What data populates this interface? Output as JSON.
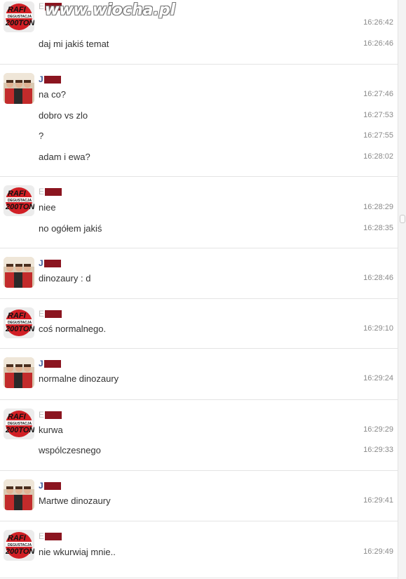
{
  "watermark": "www.wiocha.pl",
  "scrollbar": {},
  "groups": [
    {
      "sender_initial": "E",
      "messages": [
        {
          "text": "",
          "time": "16:26:42"
        },
        {
          "text": "daj mi jakiś temat",
          "time": "16:26:46"
        }
      ]
    },
    {
      "sender_initial": "J",
      "messages": [
        {
          "text": "na co?",
          "time": "16:27:46"
        },
        {
          "text": "dobro vs zlo",
          "time": "16:27:53"
        },
        {
          "text": "?",
          "time": "16:27:55"
        },
        {
          "text": "adam i ewa?",
          "time": "16:28:02"
        }
      ]
    },
    {
      "sender_initial": "E",
      "messages": [
        {
          "text": "niee",
          "time": "16:28:29"
        },
        {
          "text": "no ogółem jakiś",
          "time": "16:28:35"
        }
      ]
    },
    {
      "sender_initial": "J",
      "messages": [
        {
          "text": "dinozaury : d",
          "time": "16:28:46"
        }
      ]
    },
    {
      "sender_initial": "E",
      "messages": [
        {
          "text": "coś normalnego.",
          "time": "16:29:10"
        }
      ]
    },
    {
      "sender_initial": "J",
      "messages": [
        {
          "text": "normalne dinozaury",
          "time": "16:29:24"
        }
      ]
    },
    {
      "sender_initial": "E",
      "messages": [
        {
          "text": "kurwa",
          "time": "16:29:29"
        },
        {
          "text": "wspólczesnego",
          "time": "16:29:33"
        }
      ]
    },
    {
      "sender_initial": "J",
      "messages": [
        {
          "text": "Martwe dinozaury",
          "time": "16:29:41"
        }
      ]
    },
    {
      "sender_initial": "E",
      "messages": [
        {
          "text": "nie wkurwiaj mnie..",
          "time": "16:29:49"
        }
      ]
    }
  ],
  "avatars": {
    "E": {
      "logo_text": [
        "RAFI",
        "DEGUSTACJA",
        "200TON"
      ],
      "colors": {
        "red": "#d11f25",
        "black": "#111111"
      }
    },
    "J": {
      "colors": {
        "bg": "#d9c9b2",
        "shirt": "#c22b2b",
        "skin": "#e0b394"
      }
    }
  },
  "colors": {
    "accent": "#3b5998",
    "redaction": "#8b1520",
    "separator": "#e4e4e4",
    "timestamp": "#8a8a8a",
    "text": "#333333"
  }
}
